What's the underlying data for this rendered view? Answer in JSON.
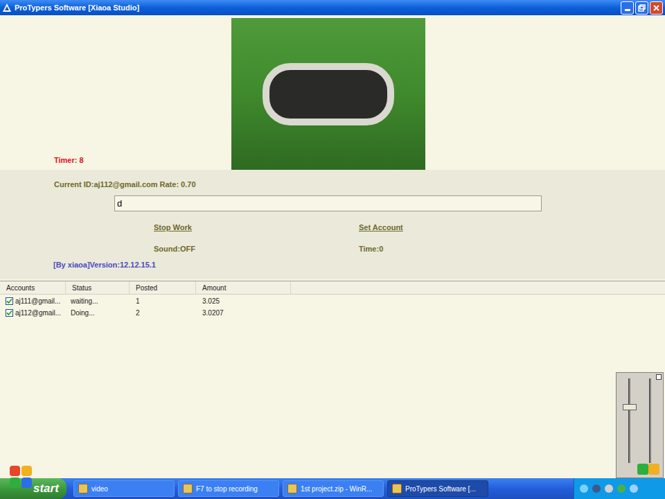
{
  "window": {
    "title": "ProTypers Software [Xiaoa Studio]"
  },
  "timer": "Timer: 8",
  "current": "Current ID:aj112@gmail.com Rate: 0.70",
  "input": {
    "value": "d"
  },
  "links": [
    {
      "label": "Stop Work"
    },
    {
      "label": "Set Account"
    }
  ],
  "info": [
    "Sound:OFF",
    "Time:0"
  ],
  "version": "[By xiaoa]Version:12.12.15.1",
  "table": {
    "columns": [
      "Accounts",
      "Status",
      "Posted",
      "Amount"
    ],
    "rows": [
      {
        "account": "aj111@gmail...",
        "status": "waiting...",
        "posted": "1",
        "amount": "3.025",
        "checked": true
      },
      {
        "account": "aj112@gmail...",
        "status": "Doing...",
        "posted": "2",
        "amount": "3.0207",
        "checked": true
      }
    ]
  },
  "mixer": {
    "sliders": [
      {
        "level": 0.67
      }
    ]
  },
  "taskbar": {
    "start": "start",
    "items": [
      {
        "label": "video",
        "selected": false
      },
      {
        "label": "F7 to stop recording",
        "selected": false
      },
      {
        "label": "1st project.zip - WinR...",
        "selected": false
      },
      {
        "label": "ProTypers Software [...",
        "selected": true
      }
    ]
  }
}
